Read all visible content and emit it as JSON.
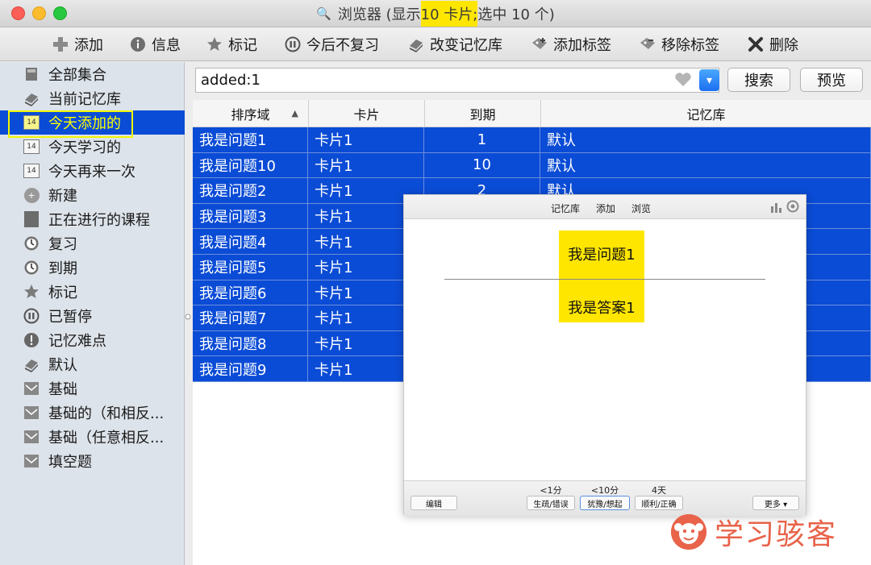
{
  "window": {
    "title_prefix": "浏览器 (显示",
    "title_highlight": " 10 卡片;",
    "title_suffix": " 选中 10 个)"
  },
  "toolbar": [
    {
      "label": "添加",
      "icon": "add-icon"
    },
    {
      "label": "信息",
      "icon": "info-icon"
    },
    {
      "label": "标记",
      "icon": "star-icon"
    },
    {
      "label": "今后不复习",
      "icon": "pause-icon"
    },
    {
      "label": "改变记忆库",
      "icon": "deck-icon"
    },
    {
      "label": "添加标签",
      "icon": "tag-add-icon"
    },
    {
      "label": "移除标签",
      "icon": "tag-remove-icon"
    },
    {
      "label": "删除",
      "icon": "delete-icon"
    }
  ],
  "sidebar": [
    {
      "label": "全部集合",
      "icon": "collection-icon"
    },
    {
      "label": "当前记忆库",
      "icon": "deck-icon"
    },
    {
      "label": "今天添加的",
      "icon": "calendar-icon",
      "selected": true
    },
    {
      "label": "今天学习的",
      "icon": "calendar-icon"
    },
    {
      "label": "今天再来一次",
      "icon": "calendar-icon"
    },
    {
      "label": "新建",
      "icon": "plus-circle-icon"
    },
    {
      "label": "正在进行的课程",
      "icon": "card-icon"
    },
    {
      "label": "复习",
      "icon": "clock-icon"
    },
    {
      "label": "到期",
      "icon": "clock-icon"
    },
    {
      "label": "标记",
      "icon": "star-icon"
    },
    {
      "label": "已暂停",
      "icon": "pause-icon"
    },
    {
      "label": "记忆难点",
      "icon": "exclamation-icon"
    },
    {
      "label": "默认",
      "icon": "deck-icon"
    },
    {
      "label": "基础",
      "icon": "note-type-icon"
    },
    {
      "label": "基础的（和相反...",
      "icon": "note-type-icon"
    },
    {
      "label": "基础（任意相反...",
      "icon": "note-type-icon"
    },
    {
      "label": "填空题",
      "icon": "note-type-icon"
    }
  ],
  "search": {
    "value": "added:1",
    "search_button": "搜索",
    "preview_button": "预览"
  },
  "table": {
    "headers": [
      "排序域",
      "卡片",
      "到期",
      "记忆库"
    ],
    "rows": [
      [
        "我是问题1",
        "卡片1",
        "1",
        "默认"
      ],
      [
        "我是问题10",
        "卡片1",
        "10",
        "默认"
      ],
      [
        "我是问题2",
        "卡片1",
        "2",
        "默认"
      ],
      [
        "我是问题3",
        "卡片1",
        "",
        ""
      ],
      [
        "我是问题4",
        "卡片1",
        "",
        ""
      ],
      [
        "我是问题5",
        "卡片1",
        "",
        ""
      ],
      [
        "我是问题6",
        "卡片1",
        "",
        ""
      ],
      [
        "我是问题7",
        "卡片1",
        "",
        ""
      ],
      [
        "我是问题8",
        "卡片1",
        "",
        ""
      ],
      [
        "我是问题9",
        "卡片1",
        "",
        ""
      ]
    ]
  },
  "preview": {
    "nav": [
      "记忆库",
      "添加",
      "浏览"
    ],
    "question": "我是问题1",
    "answer": "我是答案1",
    "edit_button": "编辑",
    "answers": [
      {
        "time": "<1分",
        "label": "生疏/错误"
      },
      {
        "time": "<10分",
        "label": "犹豫/想起"
      },
      {
        "time": "4天",
        "label": "顺利/正确"
      }
    ],
    "more_button": "更多 ▾"
  },
  "watermark": {
    "text": "学习骇客"
  },
  "colors": {
    "selection_blue": "#0b4cd6",
    "highlight_yellow": "#ffe600",
    "sidebar_bg": "#dde3ea",
    "watermark": "#e8634a"
  }
}
